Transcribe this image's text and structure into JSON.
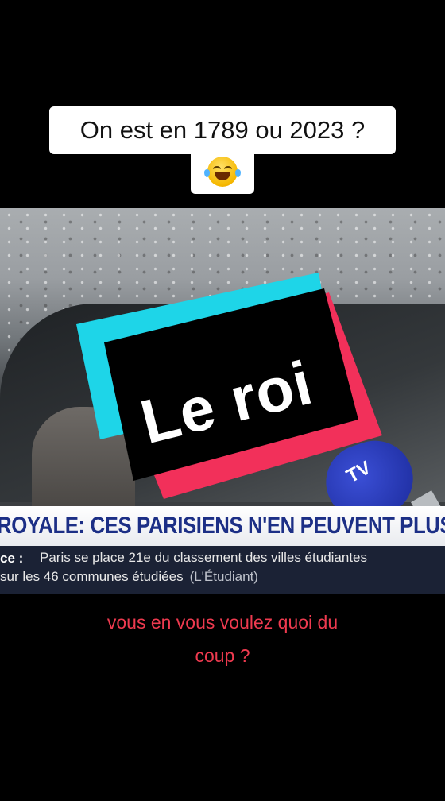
{
  "caption": {
    "line1": "On est en 1789 ou 2023 ?",
    "emoji": "face-with-tears-of-joy-icon"
  },
  "video": {
    "sticker_text": "Le roi",
    "mic_label": "TV",
    "banner": "ROYALE: CES PARISIENS N'EN PEUVENT PLUS",
    "ticker": {
      "tag": "ce :",
      "line1": "Paris se place 21e du classement des villes étudiantes",
      "line2": "sur les 46 communes étudiées",
      "source": "(L'Étudiant)"
    }
  },
  "subtitle": {
    "line1": "vous en vous voulez quoi du",
    "line2": "coup ?"
  },
  "colors": {
    "cyan": "#1ed5e8",
    "red": "#f2305a",
    "subtitle": "#ee3a4f",
    "banner_text": "#1c2f86"
  }
}
